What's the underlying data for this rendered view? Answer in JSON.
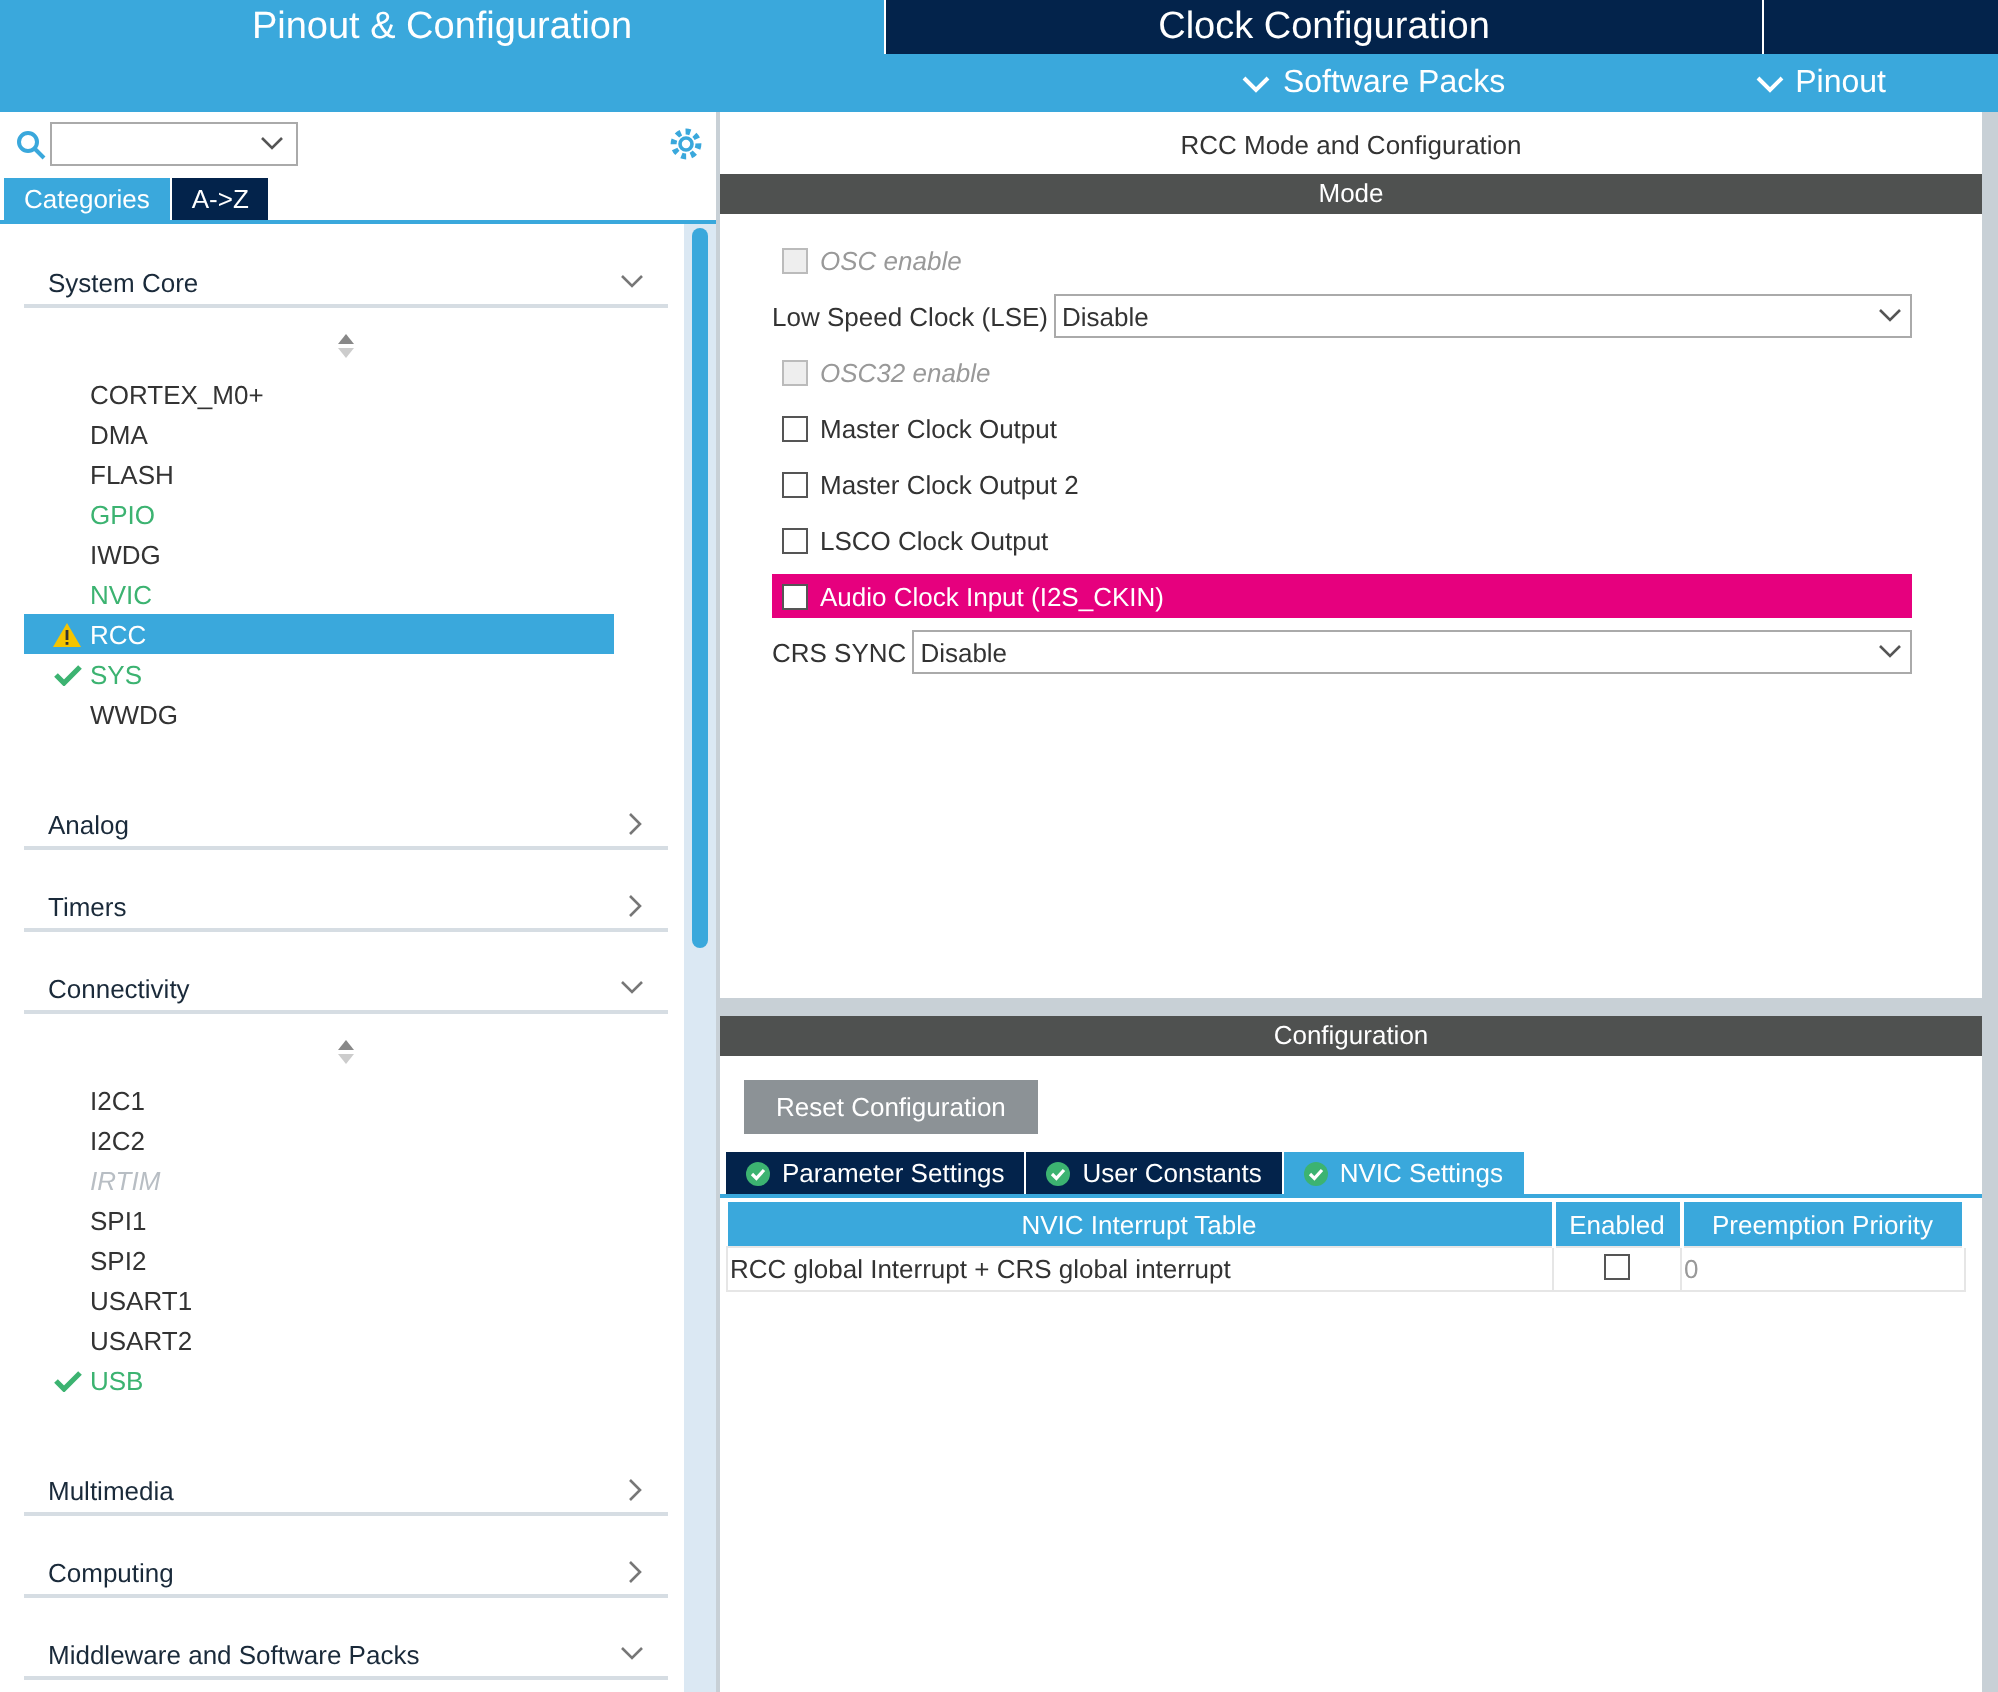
{
  "top_tabs": [
    {
      "label": "Pinout & Configuration",
      "selected": true
    },
    {
      "label": "Clock Configuration",
      "selected": false
    }
  ],
  "sub_menus": [
    "Software Packs",
    "Pinout"
  ],
  "sidebar": {
    "view_tabs": [
      {
        "label": "Categories",
        "selected": true
      },
      {
        "label": "A->Z",
        "selected": false
      }
    ],
    "categories": [
      {
        "name": "System Core",
        "expanded": true,
        "items": [
          {
            "label": "CORTEX_M0+",
            "kind": "plain",
            "selected": false
          },
          {
            "label": "DMA",
            "kind": "plain",
            "selected": false
          },
          {
            "label": "FLASH",
            "kind": "plain",
            "selected": false
          },
          {
            "label": "GPIO",
            "kind": "configured",
            "selected": false
          },
          {
            "label": "IWDG",
            "kind": "plain",
            "selected": false
          },
          {
            "label": "NVIC",
            "kind": "configured",
            "selected": false
          },
          {
            "label": "RCC",
            "kind": "warning",
            "selected": true
          },
          {
            "label": "SYS",
            "kind": "ok",
            "selected": false
          },
          {
            "label": "WWDG",
            "kind": "plain",
            "selected": false
          }
        ]
      },
      {
        "name": "Analog",
        "expanded": false
      },
      {
        "name": "Timers",
        "expanded": false
      },
      {
        "name": "Connectivity",
        "expanded": true,
        "items": [
          {
            "label": "I2C1",
            "kind": "plain",
            "selected": false
          },
          {
            "label": "I2C2",
            "kind": "plain",
            "selected": false
          },
          {
            "label": "IRTIM",
            "kind": "unavailable",
            "selected": false
          },
          {
            "label": "SPI1",
            "kind": "plain",
            "selected": false
          },
          {
            "label": "SPI2",
            "kind": "plain",
            "selected": false
          },
          {
            "label": "USART1",
            "kind": "plain",
            "selected": false
          },
          {
            "label": "USART2",
            "kind": "plain",
            "selected": false
          },
          {
            "label": "USB",
            "kind": "ok",
            "selected": false
          }
        ]
      },
      {
        "name": "Multimedia",
        "expanded": false
      },
      {
        "name": "Computing",
        "expanded": false
      },
      {
        "name": "Middleware and Software Packs",
        "expanded": true
      }
    ]
  },
  "panel": {
    "title": "RCC Mode and Configuration",
    "mode_header": "Mode",
    "mode_rows": [
      {
        "kind": "checkbox",
        "label": "OSC enable",
        "checked": false,
        "disabled": true,
        "error": false
      },
      {
        "kind": "select",
        "label": "Low Speed Clock (LSE)",
        "value": "Disable"
      },
      {
        "kind": "checkbox",
        "label": "OSC32 enable",
        "checked": false,
        "disabled": true,
        "error": false
      },
      {
        "kind": "checkbox",
        "label": "Master Clock Output",
        "checked": false,
        "disabled": false,
        "error": false
      },
      {
        "kind": "checkbox",
        "label": "Master Clock Output 2",
        "checked": false,
        "disabled": false,
        "error": false
      },
      {
        "kind": "checkbox",
        "label": "LSCO Clock Output",
        "checked": false,
        "disabled": false,
        "error": false
      },
      {
        "kind": "checkbox",
        "label": "Audio Clock Input (I2S_CKIN)",
        "checked": false,
        "disabled": false,
        "error": true
      },
      {
        "kind": "select",
        "label": "CRS SYNC",
        "value": "Disable"
      }
    ],
    "config_header": "Configuration",
    "reset_button": "Reset Configuration",
    "config_tabs": [
      {
        "label": "Parameter Settings",
        "selected": false
      },
      {
        "label": "User Constants",
        "selected": false
      },
      {
        "label": "NVIC Settings",
        "selected": true
      }
    ],
    "table": {
      "columns": [
        "NVIC Interrupt Table",
        "Enabled",
        "Preemption Priority"
      ],
      "rows": [
        {
          "name": "RCC global Interrupt + CRS global interrupt",
          "enabled": false,
          "priority": "0"
        }
      ]
    }
  }
}
